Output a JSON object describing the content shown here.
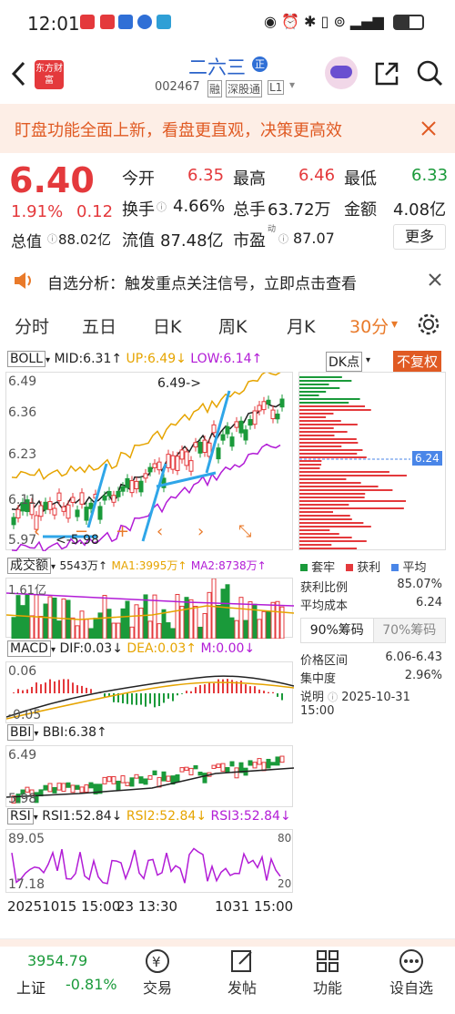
{
  "status": {
    "time": "12:01",
    "battery": "57"
  },
  "header": {
    "name": "二六三",
    "code": "002467",
    "tags": [
      "融",
      "深股通",
      "L1"
    ],
    "logo": "东方财富",
    "badge": "正"
  },
  "banner": {
    "text": "盯盘功能全面上新，看盘更直观，决策更高效"
  },
  "quote": {
    "price": "6.40",
    "pct": "1.91%",
    "chg": "0.12",
    "open_l": "今开",
    "open": "6.35",
    "high_l": "最高",
    "high": "6.46",
    "low_l": "最低",
    "low": "6.33",
    "turn_l": "换手",
    "turn": "4.66%",
    "vol_l": "总手",
    "vol": "63.72万",
    "amt_l": "金额",
    "amt": "4.08亿",
    "cap_l": "总值",
    "cap": "88.02亿",
    "flt_l": "流值",
    "flt": "87.48亿",
    "pe_l": "市盈",
    "pe_sup": "动",
    "pe": "87.07",
    "more": "更多"
  },
  "notice": {
    "text": "自选分析：触发重点关注信号，立即点击查看"
  },
  "tabs": [
    "分时",
    "五日",
    "日K",
    "周K",
    "月K",
    "30分"
  ],
  "boll": {
    "name": "BOLL",
    "mid": "MID:6.31↑",
    "up": "UP:6.49↓",
    "low": "LOW:6.14↑",
    "y1": "6.49",
    "y2": "6.36",
    "y3": "6.23",
    "y4": "6.11",
    "y5": "5.97",
    "peak": "6.49->",
    "trough": "<-5.98"
  },
  "vol": {
    "name": "成交额",
    "v": "5543万↑",
    "ma1": "MA1:3995万↑",
    "ma2": "MA2:8738万↑",
    "top": "1.61亿"
  },
  "macd": {
    "name": "MACD",
    "dif": "DIF:0.03↓",
    "dea": "DEA:0.03↑",
    "m": "M:0.00↓",
    "top": "0.06",
    "bot": "-0.05"
  },
  "bbi": {
    "name": "BBI",
    "v": "BBI:6.38↑",
    "top": "6.49",
    "bot": "5.98"
  },
  "rsi": {
    "name": "RSI",
    "r1": "RSI1:52.84↓",
    "r2": "RSI2:52.84↓",
    "r3": "RSI3:52.84↓",
    "top": "89.05",
    "bot": "17.18",
    "r80": "80",
    "r20": "20"
  },
  "time_axis": {
    "start": "20251015 15:00",
    "mid": "23 13:30",
    "end": "1031 15:00"
  },
  "right": {
    "dk": "DK点",
    "fq": "不复权",
    "cost": "6.24",
    "legend": [
      "套牢",
      "获利",
      "平均"
    ],
    "profit_l": "获利比例",
    "profit": "85.07%",
    "avg_l": "平均成本",
    "avg": "6.24",
    "t90": "90%筹码",
    "t70": "70%筹码",
    "range_l": "价格区间",
    "range": "6.06-6.43",
    "conc_l": "集中度",
    "conc": "2.96%",
    "note_l": "说明",
    "note": "2025-10-31 15:00"
  },
  "nav": {
    "index_val": "3954.79",
    "index_name": "上证",
    "index_pct": "-0.81%",
    "items": [
      "交易",
      "发帖",
      "功能",
      "设自选"
    ]
  }
}
